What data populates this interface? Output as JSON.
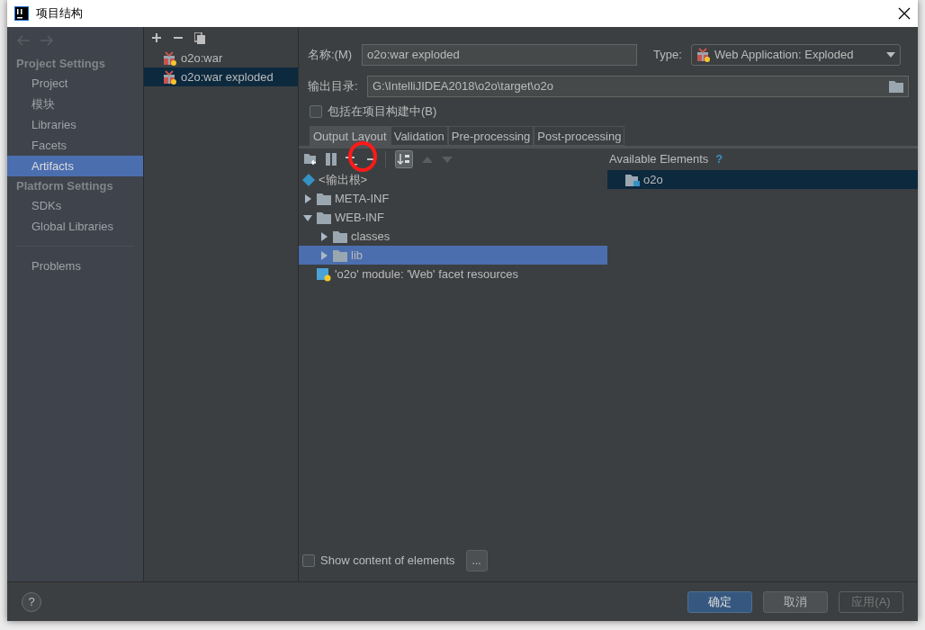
{
  "window": {
    "title": "项目结构"
  },
  "sidebar": {
    "sections": [
      {
        "heading": "Project Settings",
        "items": [
          {
            "label": "Project",
            "selected": false
          },
          {
            "label": "模块",
            "selected": false
          },
          {
            "label": "Libraries",
            "selected": false
          },
          {
            "label": "Facets",
            "selected": false
          },
          {
            "label": "Artifacts",
            "selected": true
          }
        ]
      },
      {
        "heading": "Platform Settings",
        "items": [
          {
            "label": "SDKs",
            "selected": false
          },
          {
            "label": "Global Libraries",
            "selected": false
          }
        ]
      }
    ],
    "footer_items": [
      {
        "label": "Problems",
        "selected": false
      }
    ]
  },
  "artifacts": {
    "items": [
      {
        "label": "o2o:war",
        "selected": false
      },
      {
        "label": "o2o:war exploded",
        "selected": true
      }
    ]
  },
  "form": {
    "name_label": "名称:(M)",
    "name_value": "o2o:war exploded",
    "type_label": "Type:",
    "type_value": "Web Application: Exploded",
    "output_label": "输出目录:",
    "output_value": "G:\\IntelliJIDEA2018\\o2o\\target\\o2o",
    "include": {
      "label": "包括在项目构建中(B)",
      "checked": false
    }
  },
  "tabs": [
    {
      "label": "Output Layout",
      "selected": true
    },
    {
      "label": "Validation",
      "selected": false
    },
    {
      "label": "Pre-processing",
      "selected": false
    },
    {
      "label": "Post-processing",
      "selected": false
    }
  ],
  "layout_tree": [
    {
      "kind": "root",
      "label": "<输出根>",
      "selected": false
    },
    {
      "kind": "folder",
      "label": "META-INF",
      "expanded": false,
      "selected": false
    },
    {
      "kind": "folder",
      "label": "WEB-INF",
      "expanded": true,
      "selected": false,
      "children": [
        {
          "kind": "folder",
          "label": "classes",
          "expanded": false,
          "selected": false
        },
        {
          "kind": "folder",
          "label": "lib",
          "expanded": false,
          "selected": true
        }
      ]
    },
    {
      "kind": "module",
      "label": "'o2o' module: 'Web' facet resources",
      "selected": false
    }
  ],
  "available": {
    "title": "Available Elements",
    "help": "?",
    "items": [
      {
        "label": "o2o",
        "selected": true
      }
    ]
  },
  "show_content": {
    "label": "Show content of elements",
    "checked": false,
    "more": "..."
  },
  "footer": {
    "help": "?",
    "buttons": [
      {
        "label": "确定",
        "primary": true,
        "disabled": false
      },
      {
        "label": "取消",
        "primary": false,
        "disabled": false
      },
      {
        "label": "应用(A)",
        "primary": false,
        "disabled": true
      }
    ]
  }
}
